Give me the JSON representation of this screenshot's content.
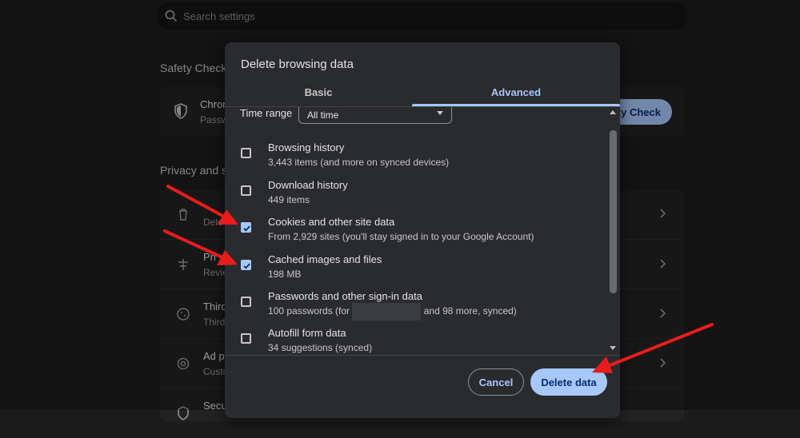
{
  "search": {
    "placeholder": "Search settings"
  },
  "safety_check": {
    "section_title": "Safety Check",
    "row_title": "Chron",
    "row_subtitle": "Passw",
    "button_label": "ety Check"
  },
  "privacy": {
    "section_title": "Privacy and s",
    "rows": [
      {
        "title": "",
        "subtitle": "Dele",
        "icon": "trash-icon"
      },
      {
        "title": "Pri",
        "subtitle": "Revie",
        "icon": "tune-icon"
      },
      {
        "title": "Third",
        "subtitle": "Third",
        "icon": "cookie-icon"
      },
      {
        "title": "Ad p",
        "subtitle": "Custo",
        "icon": "ad-privacy-icon"
      },
      {
        "title": "Secu",
        "subtitle": "",
        "icon": "shield-icon"
      }
    ]
  },
  "dialog": {
    "title": "Delete browsing data",
    "tabs": [
      {
        "label": "Basic",
        "active": false
      },
      {
        "label": "Advanced",
        "active": true
      }
    ],
    "time_range": {
      "label": "Time range",
      "value": "All time"
    },
    "items": [
      {
        "label": "Browsing history",
        "detail": "3,443 items (and more on synced devices)",
        "checked": false
      },
      {
        "label": "Download history",
        "detail": "449 items",
        "checked": false
      },
      {
        "label": "Cookies and other site data",
        "detail": "From 2,929 sites (you'll stay signed in to your Google Account)",
        "checked": true
      },
      {
        "label": "Cached images and files",
        "detail": "198 MB",
        "checked": true
      },
      {
        "label": "Passwords and other sign-in data",
        "detail_prefix": "100 passwords (for",
        "detail_suffix": "and 98 more, synced)",
        "checked": false
      },
      {
        "label": "Autofill form data",
        "detail": "34 suggestions (synced)",
        "checked": false
      }
    ],
    "buttons": {
      "cancel": "Cancel",
      "delete": "Delete data"
    }
  },
  "colors": {
    "accent": "#a8c7fa",
    "annotation_arrow": "#e81c1c"
  }
}
